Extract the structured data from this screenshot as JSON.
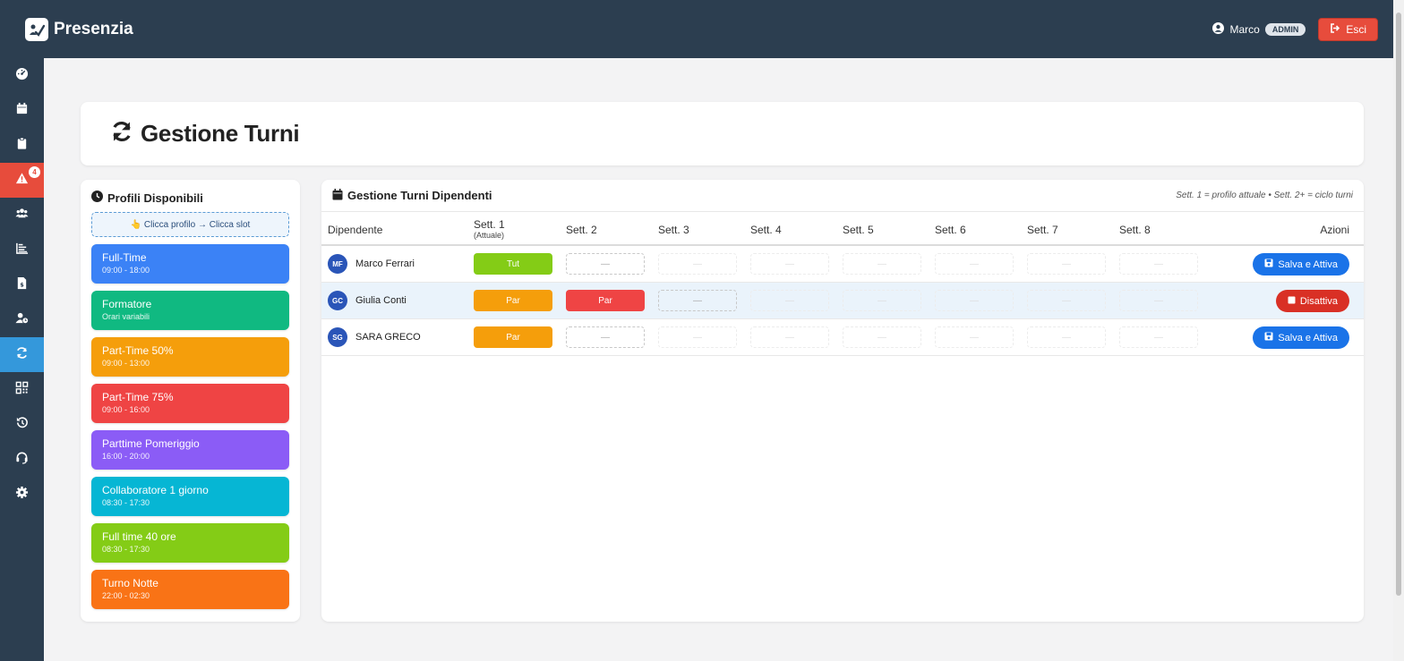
{
  "app": {
    "name": "Presenzia"
  },
  "user": {
    "name": "Marco",
    "role": "ADMIN",
    "logout_label": "Esci"
  },
  "sidebar": {
    "alert_count": "4",
    "items": [
      "dashboard-icon",
      "calendar-icon",
      "clipboard-icon",
      "alert-icon",
      "users-icon",
      "chart-icon",
      "invoice-icon",
      "user-clock-icon",
      "shifts-icon",
      "qrcode-icon",
      "history-icon",
      "support-icon",
      "settings-icon"
    ]
  },
  "page": {
    "title": "Gestione Turni"
  },
  "profiles_panel": {
    "title": "Profili Disponibili",
    "hint": "👆 Clicca profilo → Clicca slot",
    "profiles": [
      {
        "name": "Full-Time",
        "hours": "09:00 - 18:00",
        "color": "#3b82f6"
      },
      {
        "name": "Formatore",
        "hours": "Orari variabili",
        "color": "#10b981"
      },
      {
        "name": "Part-Time 50%",
        "hours": "09:00 - 13:00",
        "color": "#f59e0b"
      },
      {
        "name": "Part-Time 75%",
        "hours": "09:00 - 16:00",
        "color": "#ef4444"
      },
      {
        "name": "Parttime Pomeriggio",
        "hours": "16:00 - 20:00",
        "color": "#8b5cf6"
      },
      {
        "name": "Collaboratore 1 giorno",
        "hours": "08:30 - 17:30",
        "color": "#06b6d4"
      },
      {
        "name": "Full time 40 ore",
        "hours": "08:30 - 17:30",
        "color": "#84cc16"
      },
      {
        "name": "Turno Notte",
        "hours": "22:00 - 02:30",
        "color": "#f97316"
      }
    ]
  },
  "shifts_panel": {
    "title": "Gestione Turni Dipendenti",
    "note": "Sett. 1 = profilo attuale • Sett. 2+ = ciclo turni",
    "columns": {
      "employee": "Dipendente",
      "weeks": [
        "Sett. 1",
        "Sett. 2",
        "Sett. 3",
        "Sett. 4",
        "Sett. 5",
        "Sett. 6",
        "Sett. 7",
        "Sett. 8"
      ],
      "week1_sub": "(Attuale)",
      "actions": "Azioni"
    },
    "empty_slot": "—",
    "rows": [
      {
        "initials": "MF",
        "name": "Marco Ferrari",
        "slots": [
          {
            "label": "Tut",
            "color": "#84cc16"
          },
          {
            "label": ""
          },
          {
            "label": ""
          },
          {
            "label": ""
          },
          {
            "label": ""
          },
          {
            "label": ""
          },
          {
            "label": ""
          },
          {
            "label": ""
          }
        ],
        "action": "Salva e Attiva"
      },
      {
        "initials": "GC",
        "name": "Giulia Conti",
        "slots": [
          {
            "label": "Par",
            "color": "#f59e0b"
          },
          {
            "label": "Par",
            "color": "#ef4444"
          },
          {
            "label": ""
          },
          {
            "label": ""
          },
          {
            "label": ""
          },
          {
            "label": ""
          },
          {
            "label": ""
          },
          {
            "label": ""
          }
        ],
        "action": "Disattiva"
      },
      {
        "initials": "SG",
        "name": "SARA GRECO",
        "slots": [
          {
            "label": "Par",
            "color": "#f59e0b"
          },
          {
            "label": ""
          },
          {
            "label": ""
          },
          {
            "label": ""
          },
          {
            "label": ""
          },
          {
            "label": ""
          },
          {
            "label": ""
          },
          {
            "label": ""
          }
        ],
        "action": "Salva e Attiva"
      }
    ]
  }
}
